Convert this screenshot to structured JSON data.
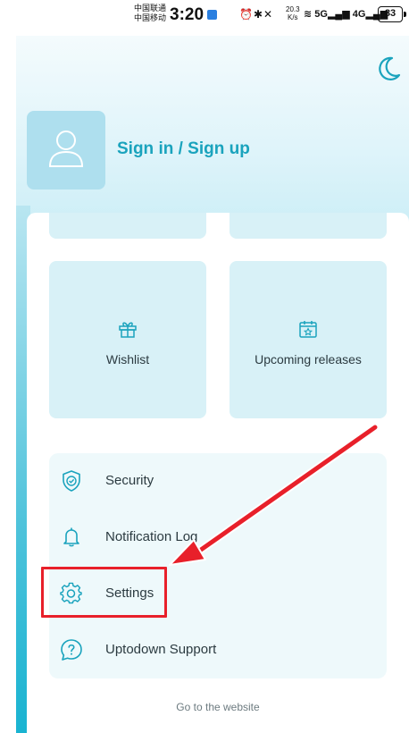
{
  "status_bar": {
    "carrier_1": "中国联通",
    "carrier_2": "中国移动",
    "time": "3:20",
    "net_speed_value": "20.3",
    "net_speed_unit": "K/s",
    "signal_1": "5G",
    "signal_2": "4G",
    "battery": "83"
  },
  "header": {
    "sign_in_label": "Sign in / Sign up",
    "theme_icon": "moon-icon",
    "avatar_icon": "user-icon"
  },
  "tiles": [
    {
      "label": "Wishlist",
      "icon": "gift-icon"
    },
    {
      "label": "Upcoming releases",
      "icon": "calendar-star-icon"
    }
  ],
  "menu": [
    {
      "label": "Security",
      "icon": "shield-check-icon"
    },
    {
      "label": "Notification Log",
      "icon": "bell-icon"
    },
    {
      "label": "Settings",
      "icon": "gear-icon"
    },
    {
      "label": "Uptodown Support",
      "icon": "help-icon"
    }
  ],
  "footer": {
    "website_link": "Go to the website"
  },
  "annotation": {
    "color": "#e8202a"
  },
  "colors": {
    "accent": "#1aa3bd",
    "tile_bg": "#d8f1f7",
    "card_bg": "#eef9fb"
  }
}
